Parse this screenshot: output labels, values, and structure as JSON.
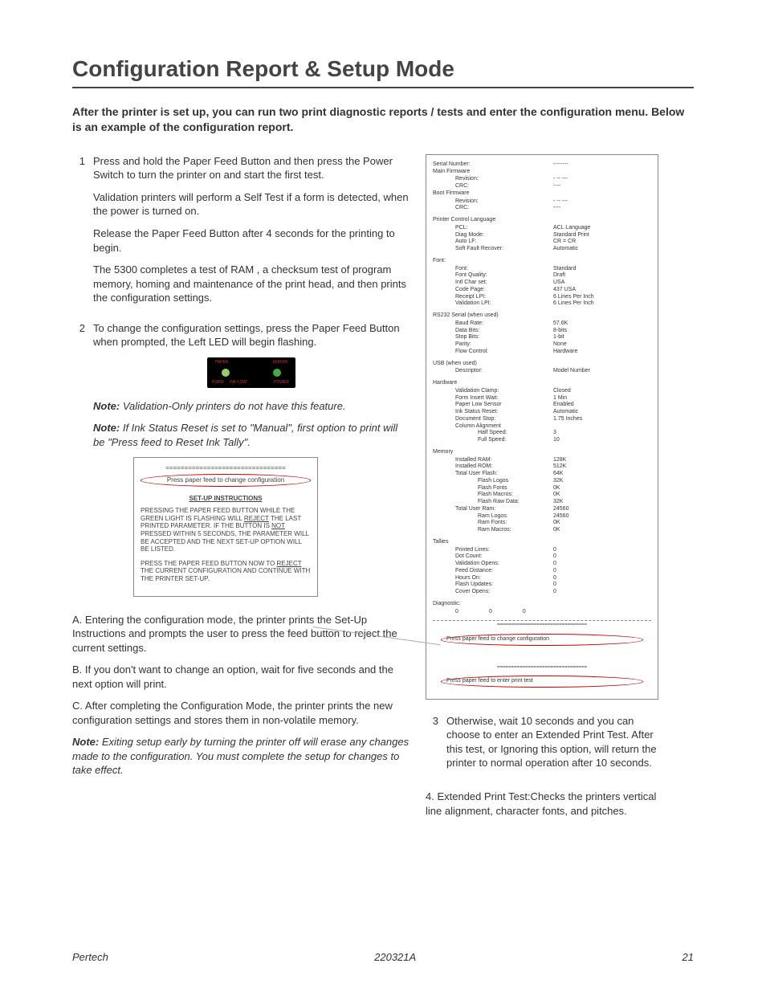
{
  "title": "Configuration Report & Setup Mode",
  "intro": "After the printer is set up, you can run two print diagnostic reports / tests and enter the configuration menu. Below is an example of the configuration report.",
  "steps": {
    "s1": {
      "num": "1",
      "p1": "Press and hold the Paper Feed Button and then press the Power Switch to turn the printer on and start the first test.",
      "p2": "Validation printers will perform a Self Test if a form is detected, when the power is turned on.",
      "p3": "Release the Paper Feed Button after 4 seconds for the printing to begin.",
      "p4": "The 5300 completes a test of RAM , a checksum test of program memory, homing and maintenance of the print head, and then prints the configuration settings."
    },
    "s2": {
      "num": "2",
      "p1": "To change the configuration settings, press the Paper Feed Button when prompted, the Left LED will begin flashing.",
      "note1_label": "Note:",
      "note1_body": " Validation-Only printers do not have this feature.",
      "note2_label": "Note:",
      "note2_body": " If Ink Status Reset is set to \"Manual\", first option to print will be \"Press feed to Reset Ink Tally\"."
    },
    "s3": {
      "num": "3",
      "p1": "Otherwise, wait 10 seconds and you can choose to enter an Extended Print Test. After this test, or Ignoring this option, will return the printer to normal operation after 10 seconds."
    },
    "s4": {
      "p1": "4. Extended Print Test:Checks the printers vertical line alignment, character fonts, and pitches."
    }
  },
  "led": {
    "paper": "PAPER",
    "error": "ERROR",
    "inklow": "INK LOW",
    "form": "FORM",
    "power": "POWER"
  },
  "setup_box": {
    "bar": "================================",
    "change": "Press paper feed to change configuration",
    "heading": "SET-UP INSTRUCTIONS",
    "p1a": "PRESSING THE PAPER FEED BUTTON WHILE THE GREEN LIGHT IS FLASHING WILL ",
    "p1u1": "REJECT",
    "p1b": " THE LAST PRINTED PARAMETER. IF THE BUTTON IS ",
    "p1u2": "NOT",
    "p1c": " PRESSED WITHIN 5 SECONDS, THE PARAMETER WILL BE ACCEPTED AND THE NEXT SET-UP OPTION WILL BE LISTED.",
    "p2a": "PRESS THE PAPER FEED BUTTON NOW TO ",
    "p2u": "REJECT",
    "p2b": " THE CURRENT CONFIGURATION AND CONTINUE WITH THE PRINTER SET-UP."
  },
  "abc": {
    "a": "A. Entering the configuration mode, the printer prints the Set-Up Instructions and prompts the user to press the feed button to reject the current settings.",
    "b": "B. If you don't want to change an option, wait for five seconds and the next option will print.",
    "c": "C. After completing the Configuration Mode, the printer prints the new configuration settings and stores them in non-volatile memory.",
    "note_label": "Note:",
    "note_body": " Exiting setup early by turning the printer off will erase any changes made to the configuration. You must complete the setup for changes to take effect."
  },
  "report": {
    "serial": {
      "k": "Serial Number:",
      "v": "--------"
    },
    "main_fw": {
      "title": "Main Firmware",
      "rev_k": "Revision:",
      "rev_v": "- -- ---",
      "crc_k": "CRC:",
      "crc_v": "----"
    },
    "boot_fw": {
      "title": "Boot Firmware",
      "rev_k": "Revision:",
      "rev_v": "- -- ---",
      "crc_k": "CRC:",
      "crc_v": "----"
    },
    "pcl": {
      "title": "Printer Control Language",
      "rows": [
        {
          "k": "PCL:",
          "v": "ACL Language"
        },
        {
          "k": "Diag Mode:",
          "v": "Standard Print"
        },
        {
          "k": "Auto LF:",
          "v": "CR = CR"
        },
        {
          "k": "Soft Fault Recover:",
          "v": "Automatic"
        }
      ]
    },
    "font": {
      "title": "Font:",
      "rows": [
        {
          "k": "Font:",
          "v": "Standard"
        },
        {
          "k": "Font Quality:",
          "v": "Draft"
        },
        {
          "k": "Intl Char set:",
          "v": "USA"
        },
        {
          "k": "Code Page:",
          "v": "437 USA"
        },
        {
          "k": "Receipt LPI:",
          "v": "6 Lines Per Inch"
        },
        {
          "k": "Validation LPI:",
          "v": "6 Lines Per Inch"
        }
      ]
    },
    "rs232": {
      "title": "RS232 Serial (when used)",
      "rows": [
        {
          "k": "Baud Rate:",
          "v": "57.6K"
        },
        {
          "k": "Data Bits:",
          "v": "8-bits"
        },
        {
          "k": "Stop Bits:",
          "v": "1-bit"
        },
        {
          "k": "Parity:",
          "v": "None"
        },
        {
          "k": "Flow Control:",
          "v": "Hardware"
        }
      ]
    },
    "usb": {
      "title": "USB (when used)",
      "rows": [
        {
          "k": "Descriptor:",
          "v": "Model Number"
        }
      ]
    },
    "hardware": {
      "title": "Hardware",
      "rows": [
        {
          "k": "Validation Clamp:",
          "v": "Closed"
        },
        {
          "k": "Form Insert Wait:",
          "v": "1 Min"
        },
        {
          "k": "Paper Low Sensor",
          "v": "Enabled"
        },
        {
          "k": "Ink Status Reset:",
          "v": "Automatic"
        },
        {
          "k": "Document Stop:",
          "v": "1.75 Inches"
        },
        {
          "k": "Column Alignment",
          "v": ""
        },
        {
          "k2": "Half Speed:",
          "v": "3"
        },
        {
          "k2": "Full Speed:",
          "v": "10"
        }
      ]
    },
    "memory": {
      "title": "Memory",
      "rows": [
        {
          "k": "Installed RAM:",
          "v": "128K"
        },
        {
          "k": "Installed ROM:",
          "v": "512K"
        },
        {
          "k": "Total User Flash:",
          "v": "64K"
        },
        {
          "k2": "Flash Logos",
          "v": "32K"
        },
        {
          "k2": "Flash Fonts",
          "v": "0K"
        },
        {
          "k2": "Flash Macros:",
          "v": "0K"
        },
        {
          "k2": "Flash Raw Data:",
          "v": "32K"
        },
        {
          "k": "Total User Ram:",
          "v": "24560"
        },
        {
          "k2": "Ram Logos:",
          "v": "24560"
        },
        {
          "k2": "Ram Fonts:",
          "v": "0K"
        },
        {
          "k2": "Ram Macros:",
          "v": "0K"
        }
      ]
    },
    "tallies": {
      "title": "Tallies",
      "rows": [
        {
          "k": "Printed Lines:",
          "v": "0"
        },
        {
          "k": "Dot Count:",
          "v": "0"
        },
        {
          "k": "Validation Opens:",
          "v": "0"
        },
        {
          "k": "Feed Distance:",
          "v": "0"
        },
        {
          "k": "Hours On:",
          "v": "0"
        },
        {
          "k": "Flash Updates:",
          "v": "0"
        },
        {
          "k": "Cover Opens:",
          "v": "0"
        }
      ]
    },
    "diag": {
      "title": "Diagnostic:",
      "v1": "0",
      "v2": "0",
      "v3": "0"
    },
    "bottom1": "Press paper feed to change configuration",
    "bottom2": "Press paper feed to enter print test"
  },
  "footer": {
    "left": "Pertech",
    "center": "220321A",
    "right": "21"
  }
}
